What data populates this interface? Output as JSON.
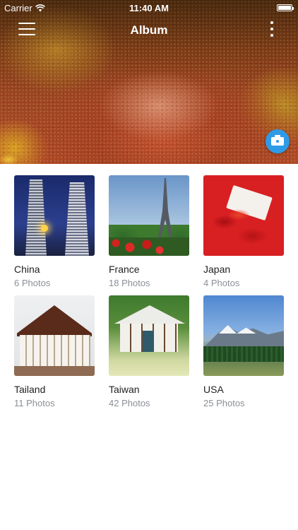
{
  "status_bar": {
    "carrier": "Carrier",
    "time": "11:40 AM"
  },
  "nav": {
    "title": "Album"
  },
  "albums": [
    {
      "name": "China",
      "count": "6 Photos"
    },
    {
      "name": "France",
      "count": "18 Photos"
    },
    {
      "name": "Japan",
      "count": "4 Photos"
    },
    {
      "name": "Tailand",
      "count": "11 Photos"
    },
    {
      "name": "Taiwan",
      "count": "42 Photos"
    },
    {
      "name": "USA",
      "count": "25 Photos"
    }
  ],
  "icons": [
    "wifi-icon",
    "battery-icon",
    "menu-icon",
    "more-vertical-icon",
    "camera-icon"
  ],
  "colors": {
    "accent": "#2f9be6",
    "secondary_text": "#8a8f96"
  }
}
